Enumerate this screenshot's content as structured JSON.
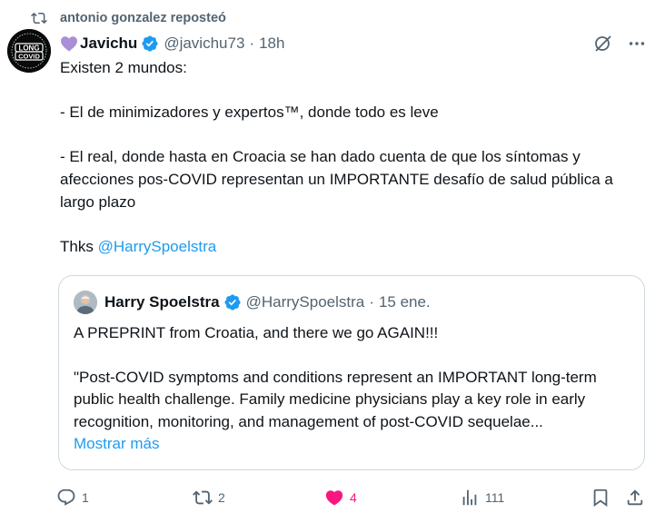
{
  "repost": {
    "label": "antonio gonzalez reposteó"
  },
  "post": {
    "author_name": "Javichu",
    "handle": "@javichu73",
    "separator": "·",
    "time": "18h",
    "avatar_text": [
      "LONG",
      "COVID"
    ],
    "lines": [
      "Existen 2 mundos:",
      "- El de minimizadores y expertos™, donde todo es leve",
      "- El real, donde hasta en Croacia se han dado cuenta de que los síntomas y afecciones pos-COVID representan un IMPORTANTE desafío de salud pública a largo plazo"
    ],
    "thanks_prefix": "Thks",
    "thanks_mention": "@HarrySpoelstra"
  },
  "quote": {
    "author_name": "Harry Spoelstra",
    "handle": "@HarrySpoelstra",
    "separator": "·",
    "time": "15 ene.",
    "line1": "A PREPRINT from Croatia, and there we go AGAIN!!!",
    "line2": "\"Post-COVID symptoms and conditions represent an IMPORTANT long-term public health challenge. Family medicine physicians play a key role in early recognition, monitoring, and management of post-COVID sequelae...",
    "show_more": "Mostrar más"
  },
  "actions": {
    "replies": "1",
    "reposts": "2",
    "likes": "4",
    "views": "111"
  },
  "colors": {
    "accent": "#1d9bf0",
    "secondary_text": "#536471",
    "like_active": "#f91880",
    "repost_active": "#00ba7c",
    "verified": "#1d9bf0"
  }
}
